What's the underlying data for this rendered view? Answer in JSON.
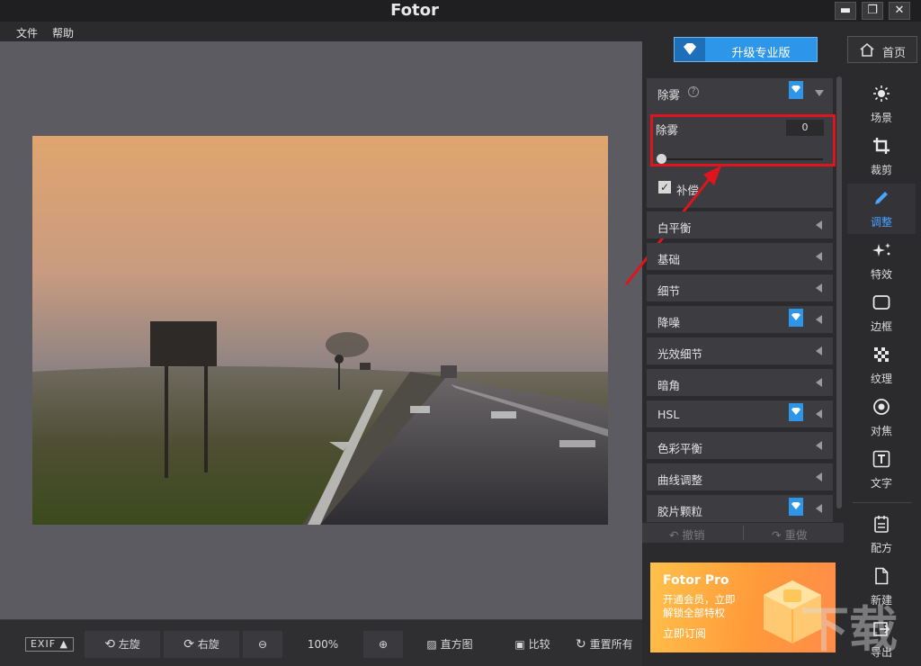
{
  "app": {
    "title": "Fotor"
  },
  "window_controls": {
    "minimize": "▬",
    "maximize": "❐",
    "close": "✕"
  },
  "menu": {
    "file": "文件",
    "help": "帮助"
  },
  "header": {
    "upgrade_label": "升级专业版",
    "home_label": "首页"
  },
  "dehaze": {
    "section_title": "除雾",
    "help_mark": "?",
    "slider_label": "除雾",
    "slider_value": "0",
    "slider_fraction": 0,
    "compensate_label": "补偿",
    "compensate_checked": true
  },
  "sections": [
    {
      "label": "白平衡",
      "pro": false
    },
    {
      "label": "基础",
      "pro": false
    },
    {
      "label": "细节",
      "pro": false
    },
    {
      "label": "降噪",
      "pro": true
    },
    {
      "label": "光效细节",
      "pro": false
    },
    {
      "label": "暗角",
      "pro": false
    },
    {
      "label": "HSL",
      "pro": true
    },
    {
      "label": "色彩平衡",
      "pro": false
    },
    {
      "label": "曲线调整",
      "pro": false
    },
    {
      "label": "胶片颗粒",
      "pro": true
    }
  ],
  "history": {
    "undo": "撤销",
    "redo": "重做"
  },
  "promo": {
    "title": "Fotor Pro",
    "line1": "开通会员，立即",
    "line2": "解锁全部特权",
    "cta": "立即订阅"
  },
  "tools": [
    {
      "label": "场景",
      "icon": "sun-icon"
    },
    {
      "label": "裁剪",
      "icon": "crop-icon"
    },
    {
      "label": "调整",
      "icon": "pencil-icon"
    },
    {
      "label": "特效",
      "icon": "sparkle-icon"
    },
    {
      "label": "边框",
      "icon": "frame-icon"
    },
    {
      "label": "纹理",
      "icon": "texture-icon"
    },
    {
      "label": "对焦",
      "icon": "focus-icon"
    },
    {
      "label": "文字",
      "icon": "text-icon"
    },
    {
      "label": "配方",
      "icon": "recipe-icon"
    },
    {
      "label": "新建",
      "icon": "new-file-icon"
    },
    {
      "label": "导出",
      "icon": "export-icon"
    }
  ],
  "bottom": {
    "exif": "EXIF ▲",
    "rotate_left": "左旋",
    "rotate_right": "右旋",
    "zoom": "100%",
    "histogram": "直方图",
    "compare": "比较",
    "reset": "重置所有"
  },
  "watermark": "下载",
  "colors": {
    "accent": "#2e96e8",
    "highlight_box": "#e0141c",
    "active_tool": "#4aa3ff",
    "promo": "#ff9a3a"
  }
}
